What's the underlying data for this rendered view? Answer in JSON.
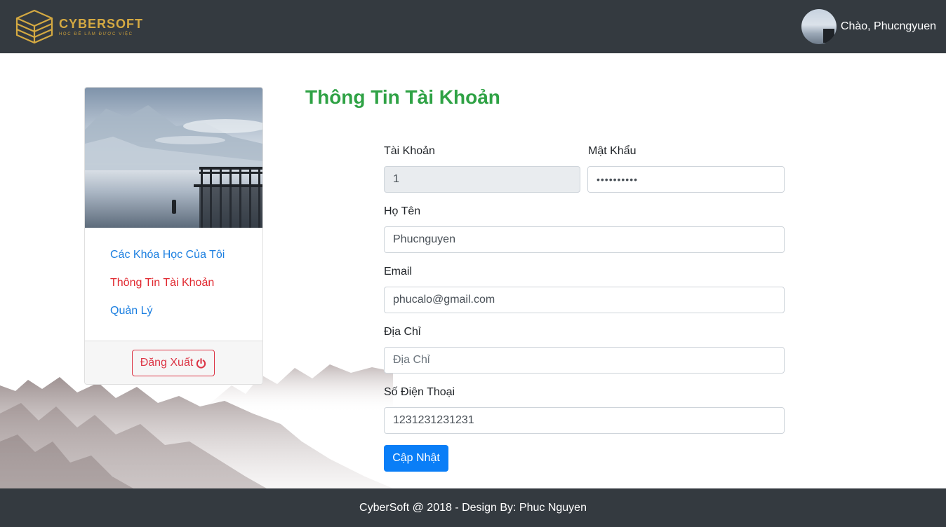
{
  "header": {
    "logo_name": "CYBERSOFT",
    "logo_tagline": "HỌC ĐỂ LÀM ĐƯỢC VIỆC",
    "greeting": "Chào, Phucngyuen"
  },
  "sidebar": {
    "menu": [
      {
        "label": "Các Khóa Học Của Tôi",
        "active": false
      },
      {
        "label": "Thông Tin Tài Khoản",
        "active": true
      },
      {
        "label": "Quản Lý",
        "active": false
      }
    ],
    "logout_label": "Đăng Xuất"
  },
  "main": {
    "title": "Thông Tin Tài Khoản",
    "fields": {
      "account": {
        "label": "Tài Khoản",
        "value": "1"
      },
      "password": {
        "label": "Mật Khẩu",
        "value": "••••••••••"
      },
      "fullname": {
        "label": "Họ Tên",
        "value": "Phucnguyen"
      },
      "email": {
        "label": "Email",
        "value": "phucalo@gmail.com"
      },
      "address": {
        "label": "Địa Chỉ",
        "placeholder": "Địa Chỉ"
      },
      "phone": {
        "label": "Số Điện Thoại",
        "value": "1231231231231"
      }
    },
    "update_label": "Cập Nhật"
  },
  "footer": {
    "text": "CyberSoft @ 2018 - Design By: Phuc Nguyen"
  },
  "colors": {
    "header_bg": "#343a40",
    "title_green": "#2fa245",
    "link_blue": "#1a7ee0",
    "active_red": "#e0262d",
    "primary_btn": "#0a7ef7",
    "logo_gold": "#d4a942"
  }
}
